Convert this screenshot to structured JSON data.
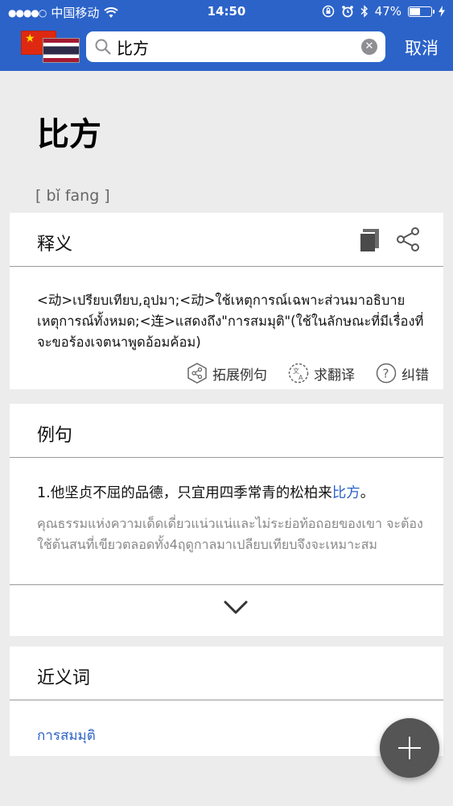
{
  "status_bar": {
    "carrier": "中国移动",
    "time": "14:50",
    "battery": "47%",
    "battery_level": 0.47
  },
  "navbar": {
    "source_flag": "china-flag",
    "target_flag": "thailand-flag",
    "search_value": "比方",
    "cancel_label": "取消"
  },
  "entry": {
    "headword": "比方",
    "pinyin": "[  bǐ fang  ]"
  },
  "definition_card": {
    "title": "释义",
    "text": "<动>เปรียบเทียบ,อุปมา;<动>ใช้เหตุการณ์เฉพาะส่วนมาอธิบายเหตุการณ์ทั้งหมด;<连>แสดงถึง\"การสมมุติ\"(ใช้ในลักษณะที่มีเรื่องที่จะขอร้องเจตนาพูดอ้อมค้อม)",
    "actions": [
      {
        "label": "拓展例句",
        "icon": "share-hexagon-icon"
      },
      {
        "label": "求翻译",
        "icon": "translate-icon"
      },
      {
        "label": "纠错",
        "icon": "question-icon"
      }
    ]
  },
  "examples_card": {
    "title": "例句",
    "example_prefix": "1.他坚贞不屈的品德，只宜用四季常青的松柏来",
    "example_highlight": "比方",
    "example_suffix": "。",
    "translation": "คุณธรรมแห่งความเด็ดเดี่ยวแน่วแน่และไม่ระย่อท้อถอยของเขา จะต้องใช้ต้นสนที่เขียวตลอดทั้ง4ฤดูกาลมาเปลียบเทียบจึงจะเหมาะสม"
  },
  "synonyms_card": {
    "title": "近义词",
    "items": [
      "การสมมุติ"
    ]
  },
  "colors": {
    "primary": "#2c63c9",
    "background": "#ececec",
    "fab": "#555555"
  }
}
